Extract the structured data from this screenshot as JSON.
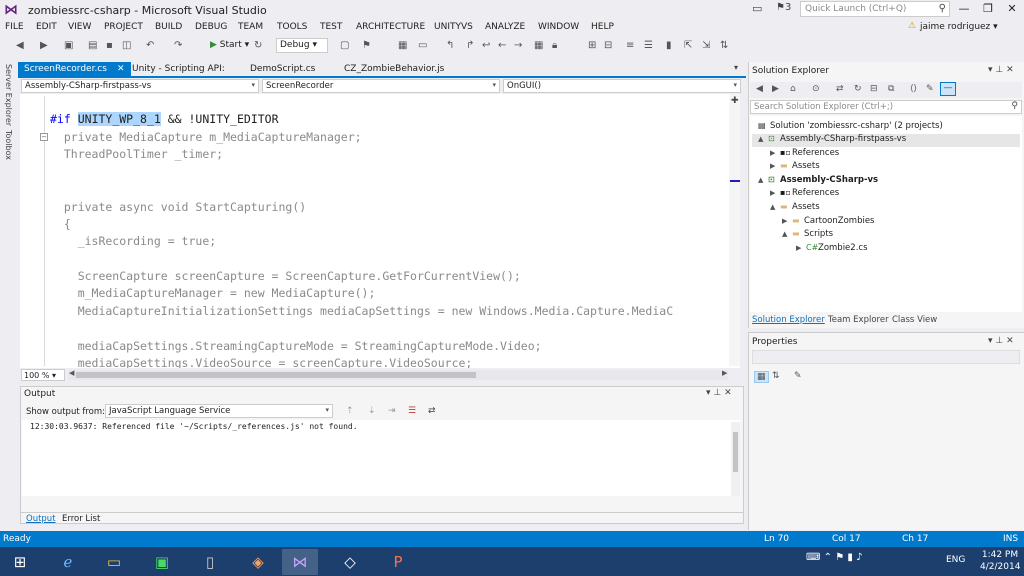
{
  "window": {
    "title": "zombiessrc-csharp - Microsoft Visual Studio",
    "notification_count": "3",
    "quick_launch_placeholder": "Quick Launch (Ctrl+Q)",
    "user": "jaime rodriguez"
  },
  "menu": [
    "FILE",
    "EDIT",
    "VIEW",
    "PROJECT",
    "BUILD",
    "DEBUG",
    "TEAM",
    "TOOLS",
    "TEST",
    "ARCHITECTURE",
    "UNITYVS",
    "ANALYZE",
    "WINDOW",
    "HELP"
  ],
  "toolbar": {
    "start_label": "Start",
    "configuration": "Debug"
  },
  "left_strip": [
    "Server Explorer",
    "Toolbox"
  ],
  "doc_tabs": [
    {
      "label": "ScreenRecorder.cs",
      "active": true
    },
    {
      "label": "Unity - Scripting API:"
    },
    {
      "label": "DemoScript.cs"
    },
    {
      "label": "CZ_ZombieBehavior.js"
    }
  ],
  "nav": {
    "project": "Assembly-CSharp-firstpass-vs",
    "type": "ScreenRecorder",
    "member": "OnGUI()"
  },
  "editor": {
    "zoom": "100 %",
    "lines": [
      {
        "kw": "#if",
        "highlight": "UNITY_WP_8_1",
        "rest": " && !UNITY_EDITOR"
      },
      {
        "text": "  private MediaCapture m_MediaCaptureManager;"
      },
      {
        "text": "  ThreadPoolTimer _timer;"
      },
      {
        "text": ""
      },
      {
        "text": ""
      },
      {
        "text": "  private async void StartCapturing()"
      },
      {
        "text": "  {"
      },
      {
        "text": "    _isRecording = true;"
      },
      {
        "text": ""
      },
      {
        "text": "    ScreenCapture screenCapture = ScreenCapture.GetForCurrentView();"
      },
      {
        "text": "    m_MediaCaptureManager = new MediaCapture();"
      },
      {
        "text": "    MediaCaptureInitializationSettings mediaCapSettings = new Windows.Media.Capture.MediaC"
      },
      {
        "text": ""
      },
      {
        "text": "    mediaCapSettings.StreamingCaptureMode = StreamingCaptureMode.Video;"
      },
      {
        "text": "    mediaCapSettings.VideoSource = screenCapture.VideoSource;"
      }
    ]
  },
  "output": {
    "title": "Output",
    "show_from_label": "Show output from:",
    "show_from_value": "JavaScript Language Service",
    "text": "12:30:03.9637: Referenced file '~/Scripts/_references.js' not found.",
    "tabs": [
      {
        "label": "Output",
        "active": true
      },
      {
        "label": "Error List"
      }
    ]
  },
  "solution_explorer": {
    "title": "Solution Explorer",
    "search_placeholder": "Search Solution Explorer (Ctrl+;)",
    "tree": [
      {
        "label": "Solution 'zombiessrc-csharp' (2 projects)",
        "level": 0,
        "icon": "solution-icon",
        "arrow": ""
      },
      {
        "label": "Assembly-CSharp-firstpass-vs",
        "level": 1,
        "icon": "project-icon",
        "arrow": "▲",
        "selected": true
      },
      {
        "label": "References",
        "level": 2,
        "icon": "references-icon",
        "arrow": "▶"
      },
      {
        "label": "Assets",
        "level": 2,
        "icon": "folder-icon",
        "arrow": "▶"
      },
      {
        "label": "Assembly-CSharp-vs",
        "level": 1,
        "icon": "project-icon",
        "arrow": "▲",
        "bold": true
      },
      {
        "label": "References",
        "level": 2,
        "icon": "references-icon",
        "arrow": "▶"
      },
      {
        "label": "Assets",
        "level": 2,
        "icon": "folder-icon",
        "arrow": "▲"
      },
      {
        "label": "CartoonZombies",
        "level": 3,
        "icon": "folder-icon",
        "arrow": "▶"
      },
      {
        "label": "Scripts",
        "level": 3,
        "icon": "folder-icon",
        "arrow": "▲"
      },
      {
        "label": "Zombie2.cs",
        "level": 4,
        "icon": "csharp-file-icon",
        "arrow": "▶"
      }
    ],
    "tabs": [
      {
        "label": "Solution Explorer",
        "active": true
      },
      {
        "label": "Team Explorer"
      },
      {
        "label": "Class View"
      }
    ]
  },
  "properties": {
    "title": "Properties"
  },
  "status": {
    "ready": "Ready",
    "ln": "Ln 70",
    "col": "Col 17",
    "ch": "Ch 17",
    "ins": "INS"
  },
  "taskbar": {
    "lang": "ENG",
    "time": "1:42 PM",
    "date": "4/2/2014"
  },
  "colors": {
    "accent": "#007acc",
    "taskbar": "#1c3f6e",
    "keyword": "#0000ff",
    "selection": "#add6ff"
  }
}
